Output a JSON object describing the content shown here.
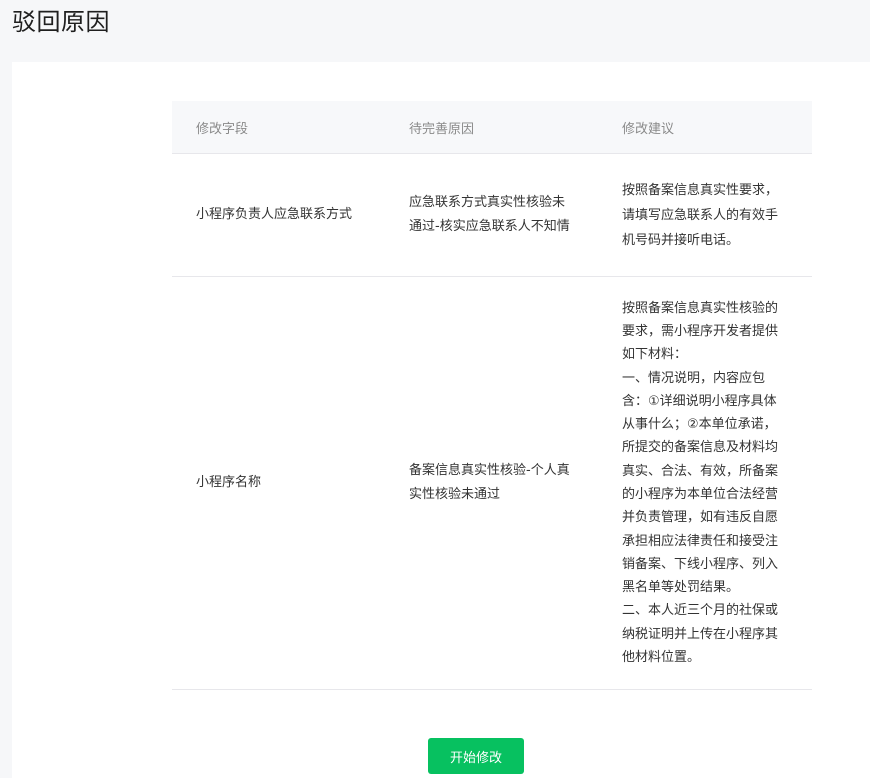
{
  "page": {
    "title": "驳回原因"
  },
  "table": {
    "headers": [
      "修改字段",
      "待完善原因",
      "修改建议"
    ],
    "rows": [
      {
        "field": "小程序负责人应急联系方式",
        "reason": "应急联系方式真实性核验未通过-核实应急联系人不知情",
        "suggestion": "按照备案信息真实性要求，请填写应急联系人的有效手机号码并接听电话。"
      },
      {
        "field": "小程序名称",
        "reason": "备案信息真实性核验-个人真实性核验未通过",
        "suggestion": "按照备案信息真实性核验的要求，需小程序开发者提供如下材料：\n一、情况说明，内容应包含：①详细说明小程序具体从事什么；②本单位承诺，所提交的备案信息及材料均真实、合法、有效，所备案的小程序为本单位合法经营并负责管理，如有违反自愿承担相应法律责任和接受注销备案、下线小程序、列入黑名单等处罚结果。\n二、本人近三个月的社保或纳税证明并上传在小程序其他材料位置。"
      }
    ]
  },
  "actions": {
    "start_edit_label": "开始修改"
  },
  "colors": {
    "accent": "#07c160",
    "background": "#f6f7f9"
  }
}
